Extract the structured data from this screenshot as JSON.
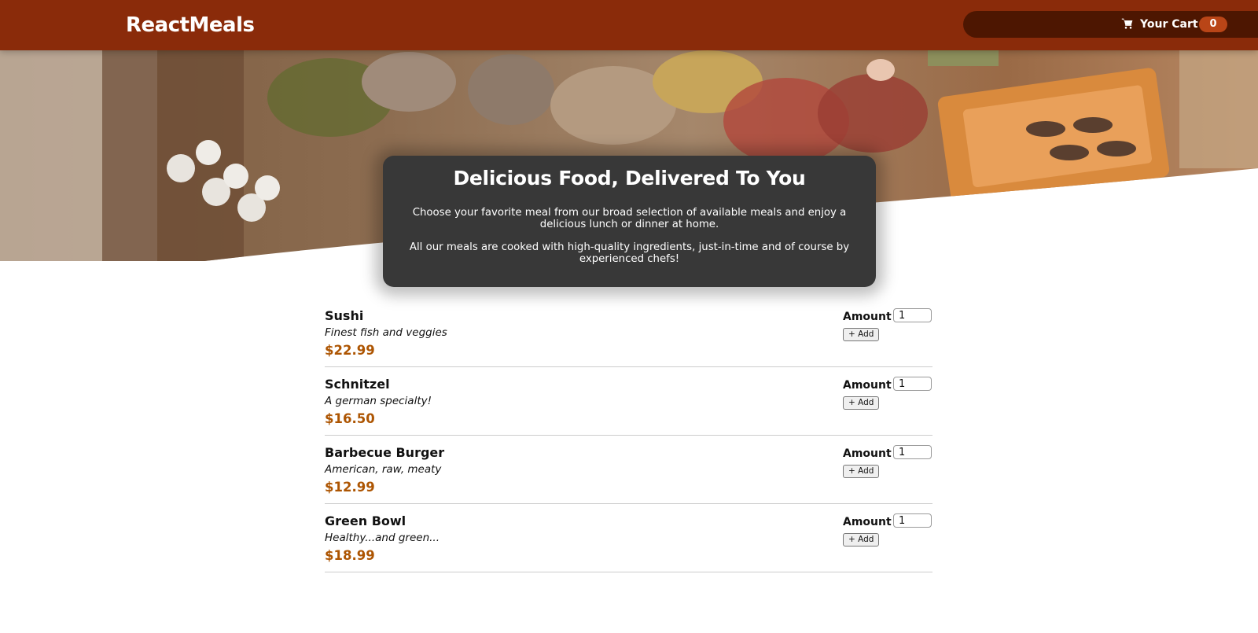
{
  "header": {
    "logo": "ReactMeals",
    "cart": {
      "icon": "shopping-cart-icon",
      "label": "Your Cart",
      "count": "0"
    }
  },
  "summary": {
    "title": "Delicious Food, Delivered To You",
    "paragraph1": "Choose your favorite meal from our broad selection of available meals and enjoy a delicious lunch or dinner at home.",
    "paragraph2": "All our meals are cooked with high-quality ingredients, just-in-time and of course by experienced chefs!"
  },
  "meals": [
    {
      "name": "Sushi",
      "description": "Finest fish and veggies",
      "price": "$22.99",
      "amount_label": "Amount",
      "amount_value": "1",
      "add_label": "+ Add"
    },
    {
      "name": "Schnitzel",
      "description": "A german specialty!",
      "price": "$16.50",
      "amount_label": "Amount",
      "amount_value": "1",
      "add_label": "+ Add"
    },
    {
      "name": "Barbecue Burger",
      "description": "American, raw, meaty",
      "price": "$12.99",
      "amount_label": "Amount",
      "amount_value": "1",
      "add_label": "+ Add"
    },
    {
      "name": "Green Bowl",
      "description": "Healthy...and green...",
      "price": "$18.99",
      "amount_label": "Amount",
      "amount_value": "1",
      "add_label": "+ Add"
    }
  ],
  "colors": {
    "header_bg": "#8a2b0a",
    "cart_bg": "#4d1601",
    "badge_bg": "#b94517",
    "summary_bg": "#383838",
    "price": "#ad5502"
  }
}
